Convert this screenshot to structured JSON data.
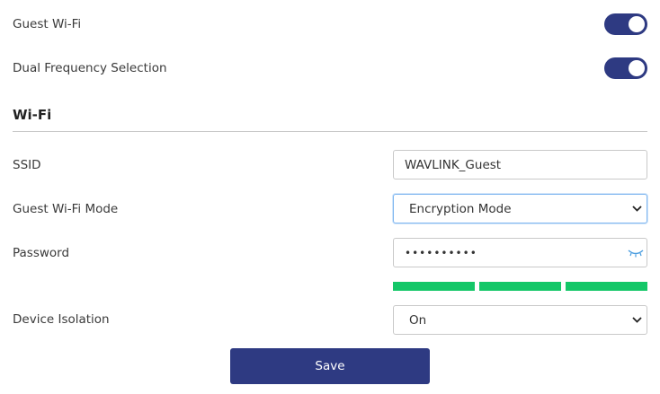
{
  "guest_wifi": {
    "label": "Guest Wi-Fi",
    "enabled": true
  },
  "dual_frequency": {
    "label": "Dual Frequency Selection",
    "enabled": true
  },
  "section": {
    "title": "Wi-Fi"
  },
  "ssid": {
    "label": "SSID",
    "value": "WAVLINK_Guest"
  },
  "mode": {
    "label": "Guest Wi-Fi Mode",
    "value": "Encryption Mode"
  },
  "password": {
    "label": "Password",
    "value": "••••••••••",
    "strength_segments_filled": 3,
    "strength_segments_total": 3
  },
  "isolation": {
    "label": "Device Isolation",
    "value": "On"
  },
  "save": {
    "label": "Save"
  },
  "colors": {
    "accent": "#2e3a82",
    "strength": "#14c768",
    "eye_icon": "#4a9de0"
  }
}
